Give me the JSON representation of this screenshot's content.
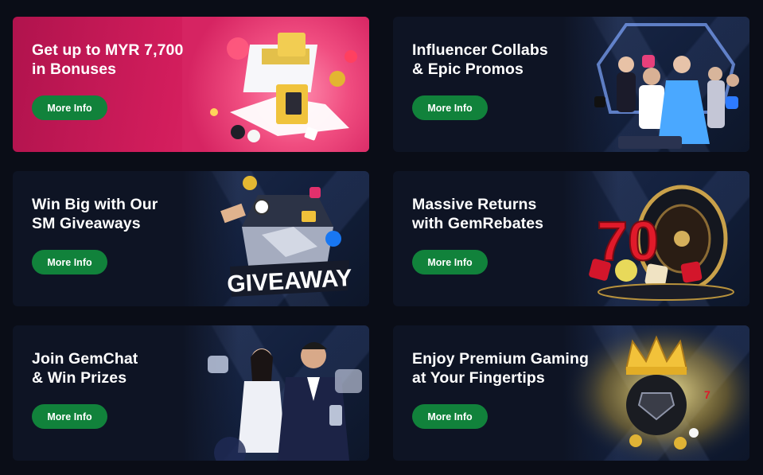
{
  "promos": [
    {
      "title": "Get up to MYR 7,700\nin Bonuses",
      "button": "More Info",
      "art": "gift-box-bonus-art"
    },
    {
      "title": "Influencer Collabs\n& Epic Promos",
      "button": "More Info",
      "art": "influencers-dj-art"
    },
    {
      "title": "Win Big with Our\nSM Giveaways",
      "button": "More Info",
      "art": "giveaway-box-art"
    },
    {
      "title": "Massive Returns\nwith GemRebates",
      "button": "More Info",
      "art": "roulette-slots-art"
    },
    {
      "title": "Join GemChat\n& Win Prizes",
      "button": "More Info",
      "art": "gemchat-hosts-art"
    },
    {
      "title": "Enjoy Premium Gaming\nat Your Fingertips",
      "button": "More Info",
      "art": "crowned-ball-art"
    }
  ],
  "art_text": {
    "giveaway_sign": "GIVEAWAY",
    "slot_number": "70"
  },
  "colors": {
    "page_background": "#0a0d17",
    "card_background": "#0e1424",
    "button_green": "#11823b",
    "pink_card": "#d21d5c"
  }
}
